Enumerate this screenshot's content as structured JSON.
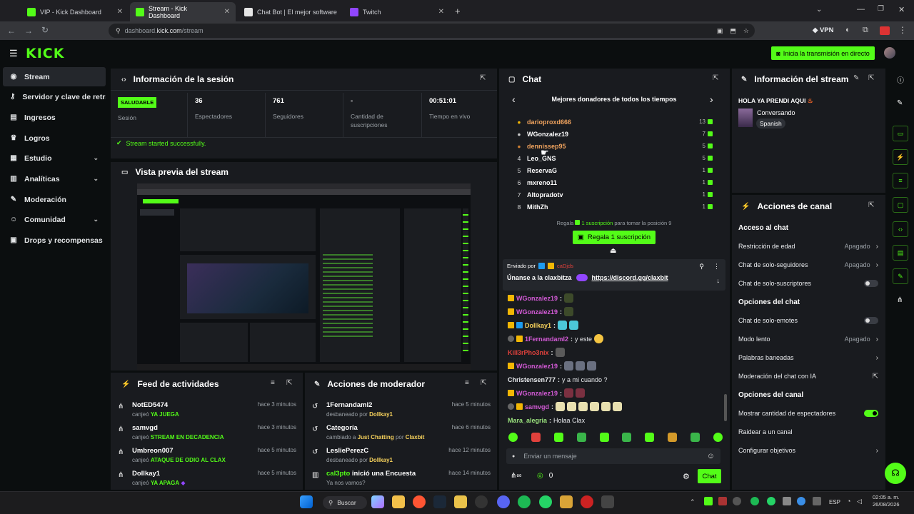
{
  "browser": {
    "tabs": [
      {
        "title": "VIP - Kick Dashboard",
        "active": false
      },
      {
        "title": "Stream - Kick Dashboard",
        "active": true
      },
      {
        "title": "Chat Bot | El mejor software pa",
        "active": false
      },
      {
        "title": "Twitch",
        "active": false
      }
    ],
    "url_prefix": "dashboard.",
    "url_domain": "kick.com",
    "url_path": "/stream",
    "vpn_label": "VPN"
  },
  "app": {
    "logo": "KICK",
    "go_live": "Inicia la transmisión en directo"
  },
  "sidebar": {
    "items": [
      {
        "label": "Stream",
        "icon": "broadcast-icon"
      },
      {
        "label": "Servidor y clave de retransmisión",
        "icon": "key-icon"
      },
      {
        "label": "Ingresos",
        "icon": "money-icon"
      },
      {
        "label": "Logros",
        "icon": "trophy-icon"
      },
      {
        "label": "Estudio",
        "icon": "studio-icon"
      },
      {
        "label": "Analíticas",
        "icon": "chart-icon"
      },
      {
        "label": "Moderación",
        "icon": "wrench-icon"
      },
      {
        "label": "Comunidad",
        "icon": "community-icon"
      },
      {
        "label": "Drops y recompensas",
        "icon": "gift-icon"
      }
    ]
  },
  "session": {
    "title": "Información de la sesión",
    "badge": "SALUDABLE",
    "stats": [
      {
        "value": "",
        "label": "Sesión"
      },
      {
        "value": "36",
        "label": "Espectadores"
      },
      {
        "value": "761",
        "label": "Seguidores"
      },
      {
        "value": "-",
        "label": "Cantidad de suscripciones"
      },
      {
        "value": "00:51:01",
        "label": "Tiempo en vivo"
      }
    ],
    "status": "Stream started successfully."
  },
  "preview": {
    "title": "Vista previa del stream"
  },
  "activity": {
    "title": "Feed de actividades",
    "items": [
      {
        "name": "NotED5474",
        "action": "canjeó",
        "reward": "YA JUEGA",
        "time": "hace 3 minutos"
      },
      {
        "name": "samvgd",
        "action": "canjeó",
        "reward": "STREAM EN DECADENCIA",
        "time": "hace 3 minutos"
      },
      {
        "name": "Umbreon007",
        "action": "canjeó",
        "reward": "ATAQUE DE ODIO AL CLAX",
        "time": "hace 5 minutos"
      },
      {
        "name": "Dollkay1",
        "action": "canjeó",
        "reward": "YA APAGA",
        "time": "hace 5 minutos"
      }
    ]
  },
  "modactions": {
    "title": "Acciones de moderador",
    "items": [
      {
        "name": "1Fernandaml2",
        "desc": "desbaneado por",
        "by": "Dollkay1",
        "time": "hace 5 minutos"
      },
      {
        "name": "Categoría",
        "desc": "cambiado a",
        "target": "Just Chatting",
        "mid": "por",
        "by": "Claxbit",
        "time": "hace 6 minutos"
      },
      {
        "name": "LesliePerezC",
        "desc": "desbaneado por",
        "by": "Dollkay1",
        "time": "hace 12 minutos"
      },
      {
        "name": "cal3pto",
        "extra": "inició una Encuesta",
        "desc": "Ya nos vamos?",
        "time": "hace 14 minutos"
      }
    ]
  },
  "chat": {
    "title": "Chat",
    "donors_title": "Mejores donadores de todos los tiempos",
    "donors": [
      {
        "rank": "",
        "name": "darioproxd666",
        "count": "13",
        "color": "#f0a35e"
      },
      {
        "rank": "",
        "name": "WGonzalez19",
        "count": "7",
        "color": "#ffffff"
      },
      {
        "rank": "",
        "name": "dennissep95",
        "count": "5",
        "color": "#f0a35e"
      },
      {
        "rank": "4",
        "name": "Leo_GNS",
        "count": "5",
        "color": "#ffffff"
      },
      {
        "rank": "5",
        "name": "ReservaG",
        "count": "1",
        "color": "#ffffff"
      },
      {
        "rank": "6",
        "name": "mxreno11",
        "count": "1",
        "color": "#ffffff"
      },
      {
        "rank": "7",
        "name": "Altopradotv",
        "count": "1",
        "color": "#ffffff"
      },
      {
        "rank": "8",
        "name": "MithZh",
        "count": "1",
        "color": "#ffffff"
      }
    ],
    "gift_hint_pre": "Regala",
    "gift_hint_link": "1 suscripción",
    "gift_hint_post": "para tomar la posición 9",
    "gift_button": "Regala 1 suscripción",
    "pinned_by": "Enviado por",
    "pinned_user": "caDjds",
    "pinned_text": "Únanse a la claxbitza",
    "pinned_link": "https://discord.gg/claxbit",
    "messages": [
      {
        "user": "WGonzalez19",
        "color": "#d35ad6",
        "text": ""
      },
      {
        "user": "WGonzalez19",
        "color": "#d35ad6",
        "text": ""
      },
      {
        "user": "Dollkay1",
        "color": "#f7d25c",
        "text": ""
      },
      {
        "user": "1Fernandaml2",
        "color": "#d35ad6",
        "text": "y este"
      },
      {
        "user": "Kill3rPho3nix",
        "color": "#e0413c",
        "text": ""
      },
      {
        "user": "WGonzalez19",
        "color": "#d35ad6",
        "text": ""
      },
      {
        "user": "Christensen777",
        "color": "#e9ebee",
        "text": "y a mi cuando ?"
      },
      {
        "user": "WGonzalez19",
        "color": "#d35ad6",
        "text": ""
      },
      {
        "user": "samvgd",
        "color": "#d35ad6",
        "text": ""
      },
      {
        "user": "Mara_alegria",
        "color": "#9be37e",
        "text": "Holaa Clax"
      }
    ],
    "input_placeholder": "Enviar un mensaje",
    "points": "0",
    "send": "Chat"
  },
  "streaminfo": {
    "title": "Información del stream",
    "stream_title": "HOLA YA PRENDI AQUI",
    "category": "Conversando",
    "language": "Spanish"
  },
  "channel": {
    "title": "Acciones de canal",
    "sections": [
      {
        "header": "Acceso al chat",
        "rows": [
          {
            "label": "Restricción de edad",
            "value": "Apagado",
            "type": "arrow"
          },
          {
            "label": "Chat de solo-seguidores",
            "value": "Apagado",
            "type": "arrow"
          },
          {
            "label": "Chat de solo-suscriptores",
            "value": "",
            "type": "toggle-off"
          }
        ]
      },
      {
        "header": "Opciones del chat",
        "rows": [
          {
            "label": "Chat de solo-emotes",
            "value": "",
            "type": "toggle-off"
          },
          {
            "label": "Modo lento",
            "value": "Apagado",
            "type": "arrow"
          },
          {
            "label": "Palabras baneadas",
            "value": "",
            "type": "arrow"
          },
          {
            "label": "Moderación del chat con IA",
            "value": "",
            "type": "external"
          }
        ]
      },
      {
        "header": "Opciones del canal",
        "rows": [
          {
            "label": "Mostrar cantidad de espectadores",
            "value": "",
            "type": "toggle-on"
          },
          {
            "label": "Raidear a un canal",
            "value": "",
            "type": "none"
          },
          {
            "label": "Configurar objetivos",
            "value": "",
            "type": "arrow"
          }
        ]
      }
    ]
  },
  "taskbar": {
    "search": "Buscar",
    "lang": "ESP",
    "time": "02:05 a. m.",
    "date": "26/08/2026"
  }
}
